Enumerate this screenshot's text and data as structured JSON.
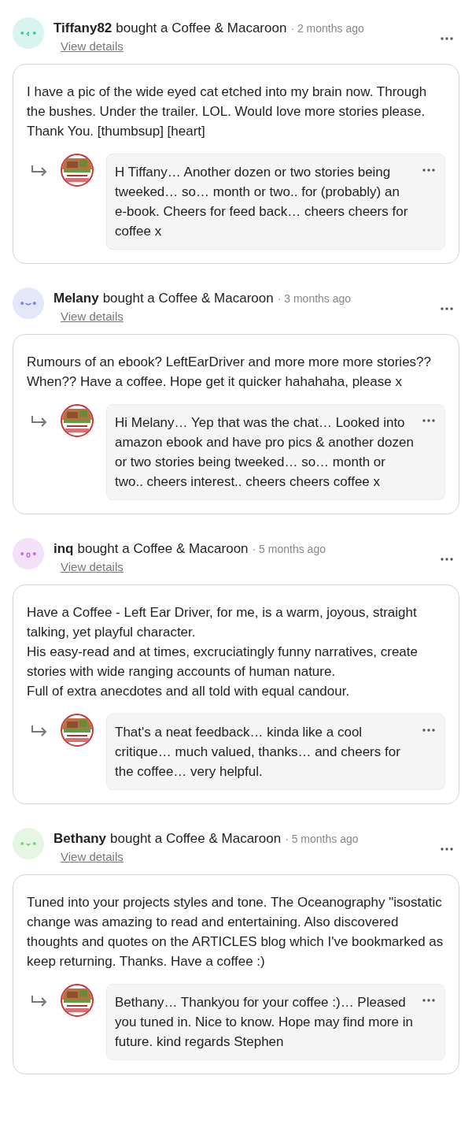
{
  "supporters": [
    {
      "name": "Tiffany82",
      "action": "bought a Coffee & Macaroon",
      "time": "· 2 months ago",
      "link": "View details",
      "avatar": {
        "color": "#3cc8a8",
        "kind": "kiss"
      },
      "message": "I have a pic of the wide eyed cat etched into my brain now. Through the bushes. Under the trailer. LOL. Would love more stories please. Thank You. [thumbsup] [heart]",
      "reply": "H Tiffany… Another dozen or two stories being tweeked… so… month or two.. for (probably) an e-book. Cheers for feed back… cheers cheers for coffee x"
    },
    {
      "name": "Melany",
      "action": "bought a Coffee & Macaroon",
      "time": "· 3 months ago",
      "link": "View details",
      "avatar": {
        "color": "#7a82e6",
        "kind": "smile"
      },
      "message": "Rumours of an ebook? LeftEarDriver and more more more stories?? When?? Have a coffee. Hope get it quicker hahahaha, please x",
      "reply": "Hi Melany… Yep that was the chat… Looked into amazon ebook and have pro pics & another dozen or two stories being tweeked… so… month or two.. cheers interest.. cheers cheers coffee x"
    },
    {
      "name": "inq",
      "action": "bought a Coffee & Macaroon",
      "time": "· 5 months ago",
      "link": "View details",
      "avatar": {
        "color": "#c46ae0",
        "kind": "o"
      },
      "message": "Have a Coffee - Left Ear Driver, for me, is a warm, joyous, straight talking, yet playful character.\nHis easy-read and at times, excruciatingly funny narratives, create stories with wide ranging accounts of human nature.\nFull of extra anecdotes and all told with equal candour.",
      "reply": "That's a neat feedback… kinda like a cool critique… much valued, thanks… and cheers for the coffee… very helpful."
    },
    {
      "name": "Bethany",
      "action": "bought a Coffee & Macaroon",
      "time": "· 5 months ago",
      "link": "View details",
      "avatar": {
        "color": "#7fd27f",
        "kind": "open"
      },
      "message": "Tuned into your projects styles and tone. The Oceanography \"isostatic change was amazing to read and entertaining. Also discovered thoughts and quotes on the ARTICLES blog which I've bookmarked as keep returning. Thanks. Have a coffee :)",
      "reply": "Bethany… Thankyou for your coffee :)… Pleased you tuned in. Nice to know. Hope may find more in future. kind regards Stephen"
    }
  ]
}
